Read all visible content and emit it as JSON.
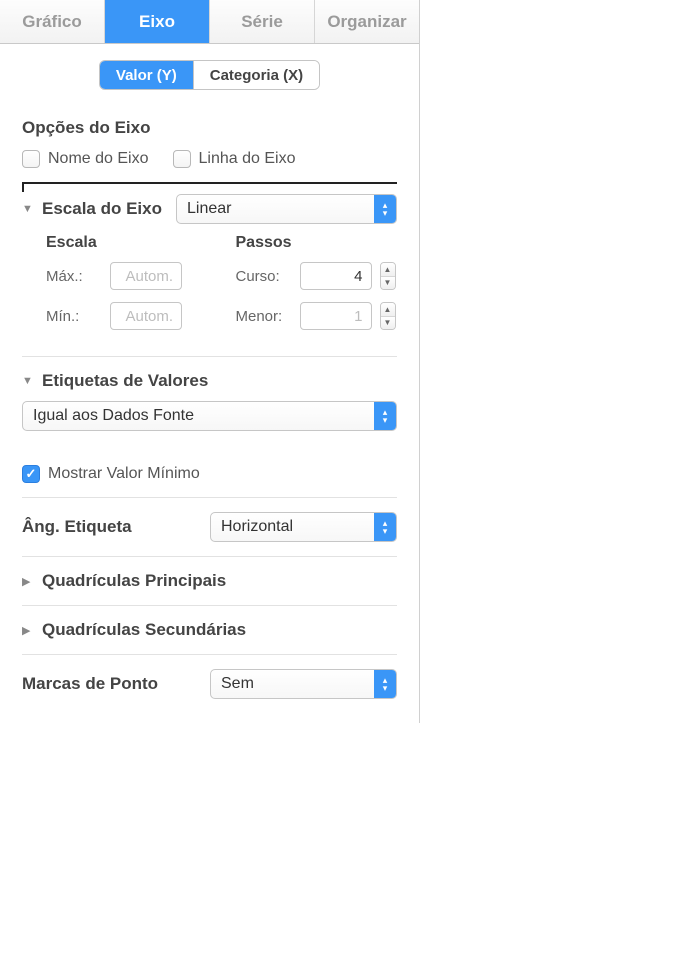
{
  "topTabs": {
    "grafico": "Gráfico",
    "eixo": "Eixo",
    "serie": "Série",
    "organizar": "Organizar"
  },
  "segmented": {
    "valorY": "Valor (Y)",
    "categoriaX": "Categoria (X)"
  },
  "axisOptions": {
    "title": "Opções do Eixo",
    "nomeDoEixo": "Nome do Eixo",
    "linhaDoEixo": "Linha do Eixo"
  },
  "axisScale": {
    "title": "Escala do Eixo",
    "selected": "Linear",
    "scaleTitle": "Escala",
    "maxLabel": "Máx.:",
    "minLabel": "Mín.:",
    "autoPlaceholder": "Autom.",
    "stepsTitle": "Passos",
    "cursoLabel": "Curso:",
    "cursoValue": "4",
    "menorLabel": "Menor:",
    "menorValue": "1"
  },
  "valueLabels": {
    "title": "Etiquetas de Valores",
    "selected": "Igual aos Dados Fonte"
  },
  "showMin": {
    "label": "Mostrar Valor Mínimo"
  },
  "labelAngle": {
    "label": "Âng. Etiqueta",
    "selected": "Horizontal"
  },
  "gridMajor": {
    "title": "Quadrículas Principais"
  },
  "gridMinor": {
    "title": "Quadrículas Secundárias"
  },
  "tickMarks": {
    "label": "Marcas de Ponto",
    "selected": "Sem"
  }
}
